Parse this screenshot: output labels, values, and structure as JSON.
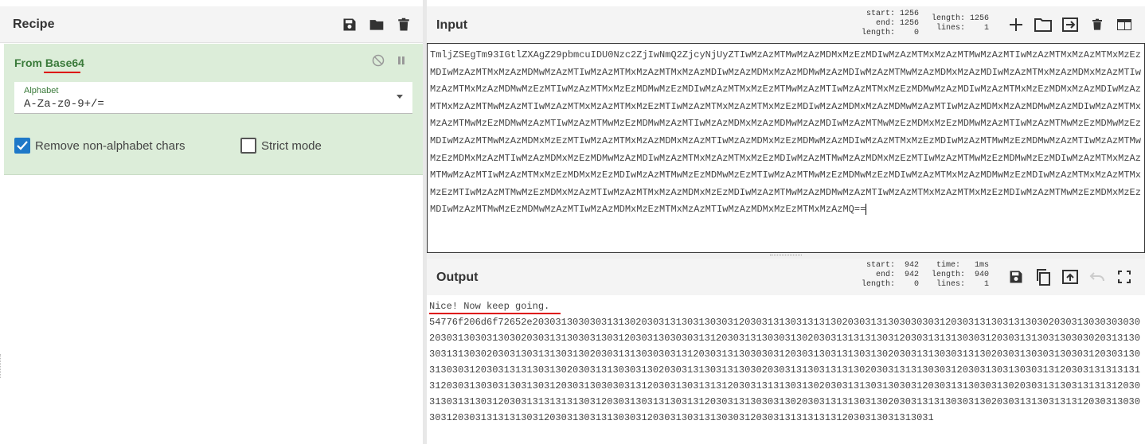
{
  "recipe": {
    "title": "Recipe",
    "operation": {
      "name": "From Base64",
      "alphabet_label": "Alphabet",
      "alphabet_value": "A-Za-z0-9+/=",
      "remove_non_alphabet_label": "Remove non-alphabet chars",
      "remove_non_alphabet_checked": true,
      "strict_mode_label": "Strict mode",
      "strict_mode_checked": false
    }
  },
  "input": {
    "title": "Input",
    "stats": {
      "start_label": "start:",
      "start": "1256",
      "end_label": "end:",
      "end": "1256",
      "length_label": "length:",
      "length_sel": "0",
      "length2_label": "length:",
      "length": "1256",
      "lines_label": "lines:",
      "lines": "1"
    },
    "text": "TmljZSEgTm93IGtlZXAgZ29pbmcuIDU0Nzc2ZjIwNmQ2ZjcyNjUyZTIwMzAzMTMwMzAzMDMxMzEzMDIwMzAzMTMxMzAzMTMwMzAzMTIwMzAzMTMxMzAzMTMxMzEzMDIwMzAzMTMxMzAzMDMwMzAzMTIwMzAzMTMxMzAzMTMxMzAzMDIwMzAzMDMxMzAzMDMwMzAzMDIwMzAzMTMwMzAzMDMxMzAzMDIwMzAzMTMxMzAzMDMxMzAzMTIwMzAzMTMxMzAzMDMwMzEzMTIwMzAzMTMxMzEzMDMwMzEzMDIwMzAzMTMxMzEzMTMwMzAzMTIwMzAzMTMxMzEzMDMwMzAzMDIwMzAzMTMxMzEzMDMxMzAzMDIwMzAzMTMxMzAzMTMwMzAzMTIwMzAzMTMxMzAzMTMxMzEzMTIwMzAzMTMxMzAzMTMxMzEzMDIwMzAzMDMxMzAzMDMwMzAzMTIwMzAzMDMxMzAzMDMwMzAzMDIwMzAzMTMxMzAzMTMwMzEzMDMwMzAzMTIwMzAzMTMwMzEzMDMwMzAzMTIwMzAzMDMxMzAzMDMwMzAzMDIwMzAzMTMwMzEzMDMxMzEzMDMwMzAzMTIwMzAzMTMwMzEzMDMwMzEzMDIwMzAzMTMwMzAzMDMxMzEzMTIwMzAzMTMxMzAzMDMxMzAzMTIwMzAzMDMxMzEzMDMwMzAzMDIwMzAzMTMxMzEzMDIwMzAzMTMwMzEzMDMwMzAzMTIwMzAzMTMwMzEzMDMxMzAzMTIwMzAzMDMxMzEzMDMwMzAzMDIwMzAzMTMxMzAzMTMxMzEzMDIwMzAzMTMwMzAzMDMxMzEzMTIwMzAzMTMwMzEzMDMwMzEzMDIwMzAzMTMxMzAzMTMwMzAzMTIwMzAzMTMxMzEzMDMxMzEzMDIwMzAzMTMwMzEzMDMwMzEzMTIwMzAzMTMwMzEzMDMwMzEzMDIwMzAzMTMxMzAzMDMwMzEzMDIwMzAzMTMxMzAzMTMxMzEzMTIwMzAzMTMwMzEzMDMxMzAzMTIwMzAzMTMxMzAzMDMxMzEzMDIwMzAzMTMwMzAzMDMwMzAzMTIwMzAzMTMxMzAzMTMxMzEzMDIwMzAzMTMwMzEzMDMxMzEzMDIwMzAzMTMwMzEzMDMwMzAzMTIwMzAzMDMxMzEzMTMxMzAzMTIwMzAzMDMxMzEzMTMxMzAzMQ=="
  },
  "output": {
    "title": "Output",
    "stats": {
      "start_label": "start:",
      "start": "942",
      "end_label": "end:",
      "end": "942",
      "length_label": "length:",
      "length_sel": "0",
      "time_label": "time:",
      "time": "1ms",
      "length2_label": "length:",
      "length": "940",
      "lines_label": "lines:",
      "lines": "1"
    },
    "line1": "Nice! Now keep going.",
    "line2": "54776f206d6f72652e2030313030303131302030313130313030312030313130313131302030313130303030312030313130313130302030313030303030203031303031303020303131303031303120303130303031312030313130303130203031313131303120303131313030312030313130313030302031313030313130302030313031313031302030313130303031312030313130303031203031303131303130203031313030313130203031303031303031203031303130303120303131313031302030313130303130203031313031313030203031313031313130203031313130303120303130313030313120303131313131312030313030313031303120303130303031312030313031313120303131313031302030313130313030312030313130303130203031313031313131203031303131303120303131313131303120303130313130313120303131303031302030313131303130203031313130303130203031313031313120303130303031203031313131303120303130313130303120303130313130303120303131313131312030313031313031"
  },
  "colors": {
    "header_bg": "#f4f4f4",
    "operation_bg": "#dcedd9",
    "operation_title": "#3a7a3a",
    "accent_blue": "#1e78c8",
    "annotation_red": "#dd0000"
  }
}
